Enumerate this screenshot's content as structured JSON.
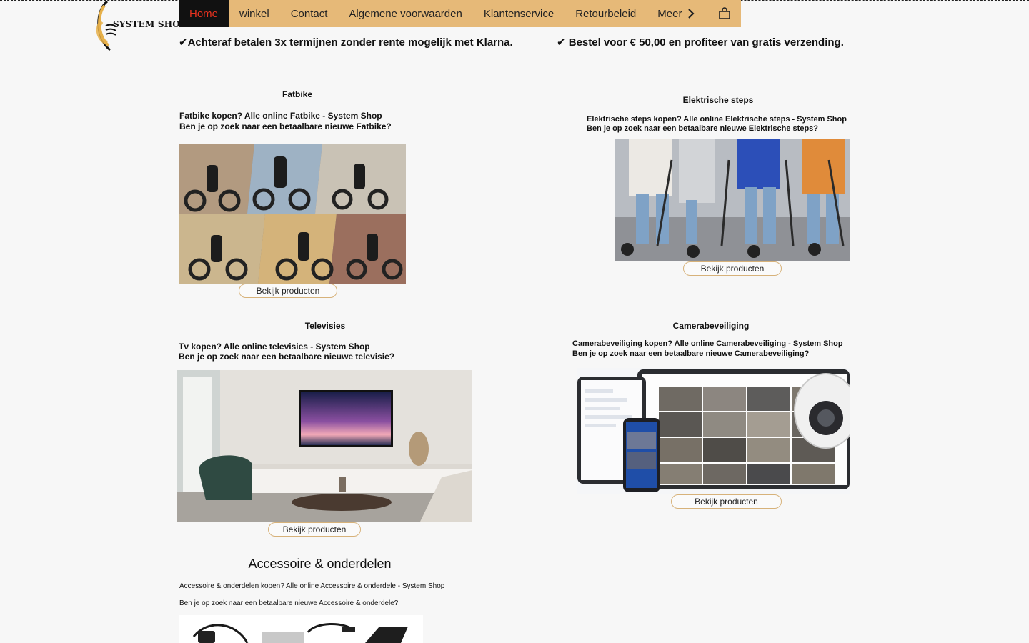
{
  "logo": {
    "text": "SYSTEM SHOP"
  },
  "nav": {
    "items": [
      "Home",
      "winkel",
      "Contact",
      "Algemene voorwaarden",
      "Klantenservice",
      "Retourbeleid",
      "Meer"
    ],
    "active_index": 0
  },
  "promos": {
    "left": "✔Achteraf betalen 3x termijnen zonder rente mogelijk met Klarna.",
    "right": "✔ Bestel voor € 50,00 en profiteer van gratis verzending."
  },
  "sections": {
    "fatbike": {
      "title": "Fatbike",
      "line1": "Fatbike kopen? Alle online Fatbike - System Shop",
      "line2": "Ben je op zoek naar een betaalbare nieuwe Fatbike?",
      "button": "Bekijk producten"
    },
    "steps": {
      "title": "Elektrische steps",
      "line1": "Elektrische steps kopen? Alle online Elektrische steps - System Shop",
      "line2": "Ben je op zoek naar een betaalbare nieuwe Elektrische steps?",
      "button": "Bekijk producten"
    },
    "tv": {
      "title": "Televisies",
      "line1": "Tv kopen? Alle online televisies - System Shop",
      "line2": "Ben je op zoek naar een betaalbare nieuwe televisie?",
      "button": "Bekijk producten"
    },
    "camera": {
      "title": "Camerabeveiliging",
      "line1": "Camerabeveiliging kopen? Alle online Camerabeveiliging - System Shop",
      "line2": "Ben je op zoek naar een betaalbare nieuwe Camerabeveiliging?",
      "button": "Bekijk producten"
    },
    "accessoire": {
      "title": "Accessoire & onderdelen",
      "line1": "Accessoire & onderdelen kopen? Alle online Accessoire & onderdele - System Shop",
      "line2": "Ben je op zoek naar een betaalbare nieuwe Accessoire & onderdele?"
    }
  },
  "colors": {
    "nav_bg": "#e6b978",
    "nav_active_bg": "#111111",
    "nav_active_text": "#e8321f",
    "button_border": "#d7b27a",
    "page_bg": "#f7f7f7"
  },
  "icons": {
    "logo": "satellite-dish-logo",
    "more": "chevron-right-icon",
    "cart": "shopping-bag-icon"
  }
}
